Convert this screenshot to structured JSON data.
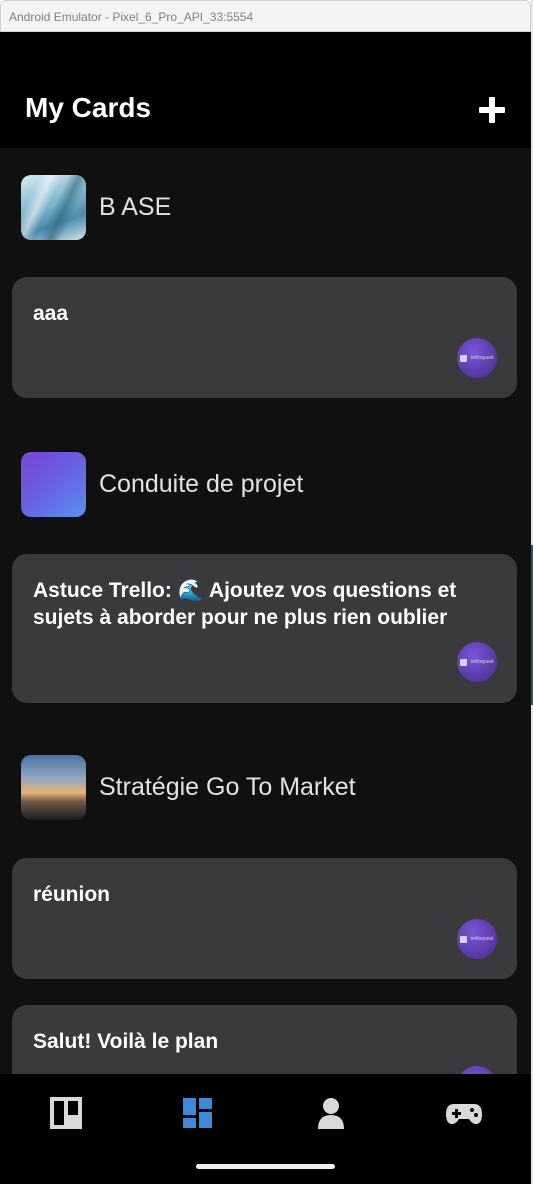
{
  "window": {
    "title": "Android Emulator - Pixel_6_Pro_API_33:5554"
  },
  "appbar": {
    "title": "My Cards",
    "add_icon": "plus-icon"
  },
  "boards": [
    {
      "name": "B ASE",
      "cards": [
        {
          "title": "aaa",
          "member": "trelloquest"
        }
      ]
    },
    {
      "name": "Conduite de projet",
      "cards": [
        {
          "title": "Astuce Trello: 🌊 Ajoutez vos questions et sujets à aborder pour ne plus rien oublier",
          "member": "trelloquest"
        }
      ]
    },
    {
      "name": "Stratégie Go To Market",
      "cards": [
        {
          "title": "réunion",
          "member": "trelloquest"
        },
        {
          "title": "Salut! Voilà le plan",
          "member": "trelloquest"
        }
      ]
    }
  ],
  "bottom_nav": {
    "items": [
      {
        "icon": "boards-icon",
        "active": false
      },
      {
        "icon": "dashboard-icon",
        "active": true
      },
      {
        "icon": "profile-icon",
        "active": false
      },
      {
        "icon": "gamepad-icon",
        "active": false
      }
    ]
  },
  "colors": {
    "background": "#101011",
    "card": "#3a3a3c",
    "nav_active": "#3d8bd8",
    "nav_inactive": "#d9d9d9"
  }
}
